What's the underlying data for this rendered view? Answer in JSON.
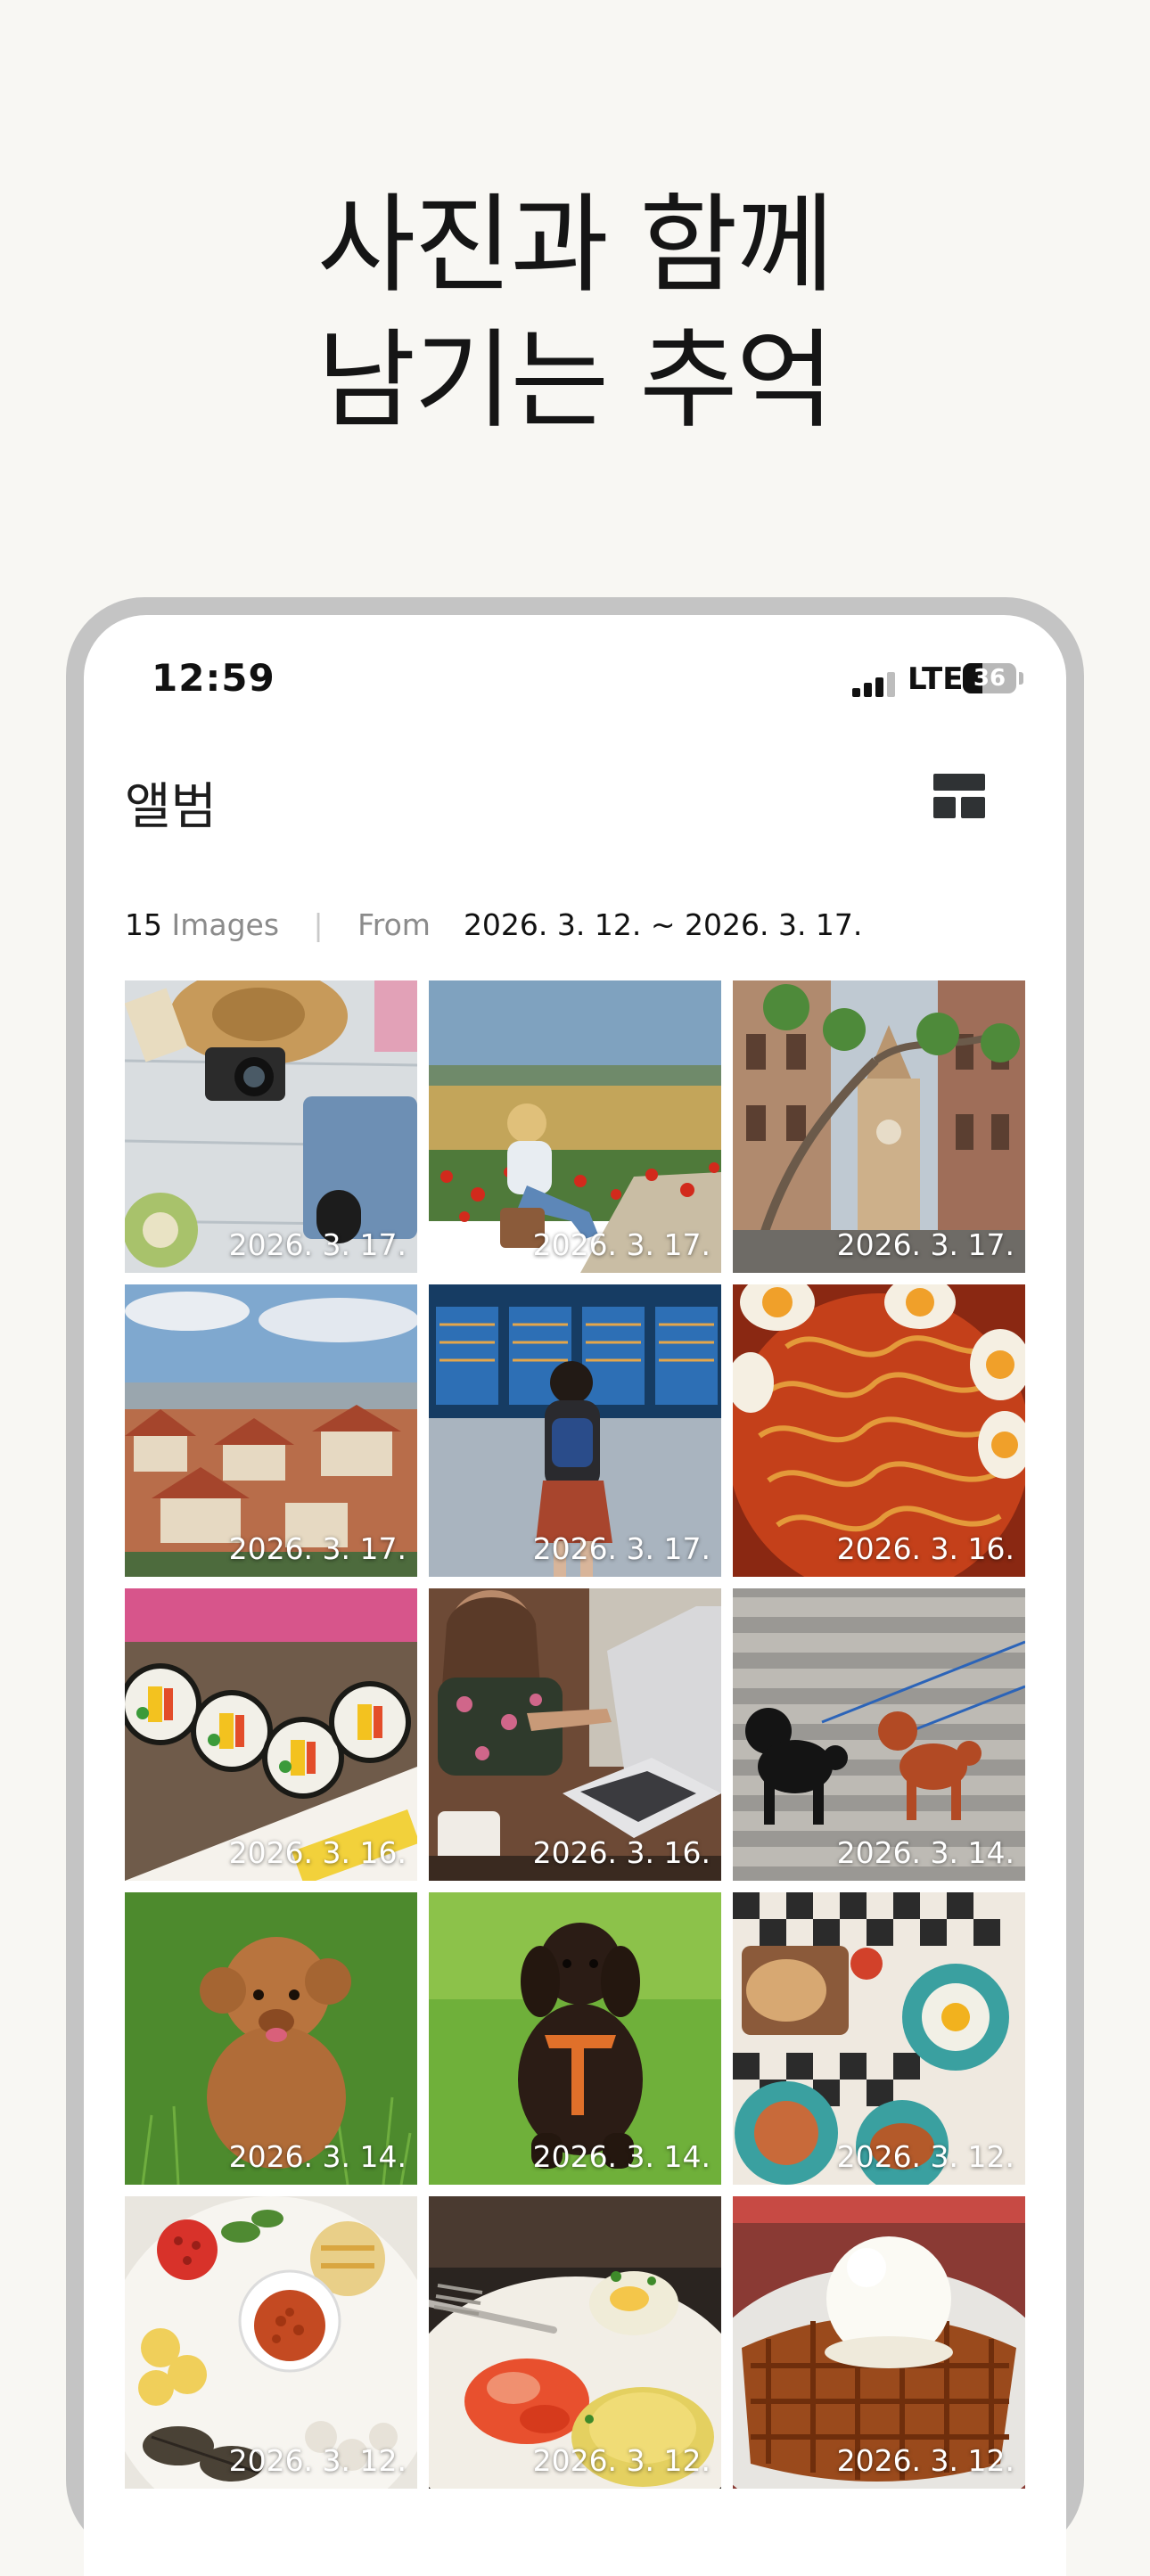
{
  "headline": {
    "line1": "사진과 함께",
    "line2": "남기는 추억"
  },
  "status_bar": {
    "time": "12:59",
    "network": "LTE",
    "battery_percent": "36"
  },
  "nav": {
    "title": "앨범",
    "layout_icon": "layout-grid-icon"
  },
  "summary": {
    "count": "15",
    "count_label": "Images",
    "from_label": "From",
    "range": "2026. 3. 12. ~ 2026. 3. 17."
  },
  "photos": [
    {
      "subject": "travel-flatlay",
      "date": "2026. 3. 17."
    },
    {
      "subject": "woman-in-poppy-field",
      "date": "2026. 3. 17."
    },
    {
      "subject": "old-town-street",
      "date": "2026. 3. 17."
    },
    {
      "subject": "city-rooftops",
      "date": "2026. 3. 17."
    },
    {
      "subject": "airport-departure-board",
      "date": "2026. 3. 17."
    },
    {
      "subject": "noodles-with-eggs",
      "date": "2026. 3. 16."
    },
    {
      "subject": "kimbap-rolls",
      "date": "2026. 3. 16."
    },
    {
      "subject": "laptop-cafe",
      "date": "2026. 3. 16."
    },
    {
      "subject": "poodles-on-steps",
      "date": "2026. 3. 14."
    },
    {
      "subject": "running-poodle",
      "date": "2026. 3. 14."
    },
    {
      "subject": "black-poodle-on-grass",
      "date": "2026. 3. 14."
    },
    {
      "subject": "brunch-table",
      "date": "2026. 3. 12."
    },
    {
      "subject": "breakfast-plate",
      "date": "2026. 3. 12."
    },
    {
      "subject": "eggs-benedict",
      "date": "2026. 3. 12."
    },
    {
      "subject": "waffle-with-ice-cream",
      "date": "2026. 3. 12."
    }
  ]
}
